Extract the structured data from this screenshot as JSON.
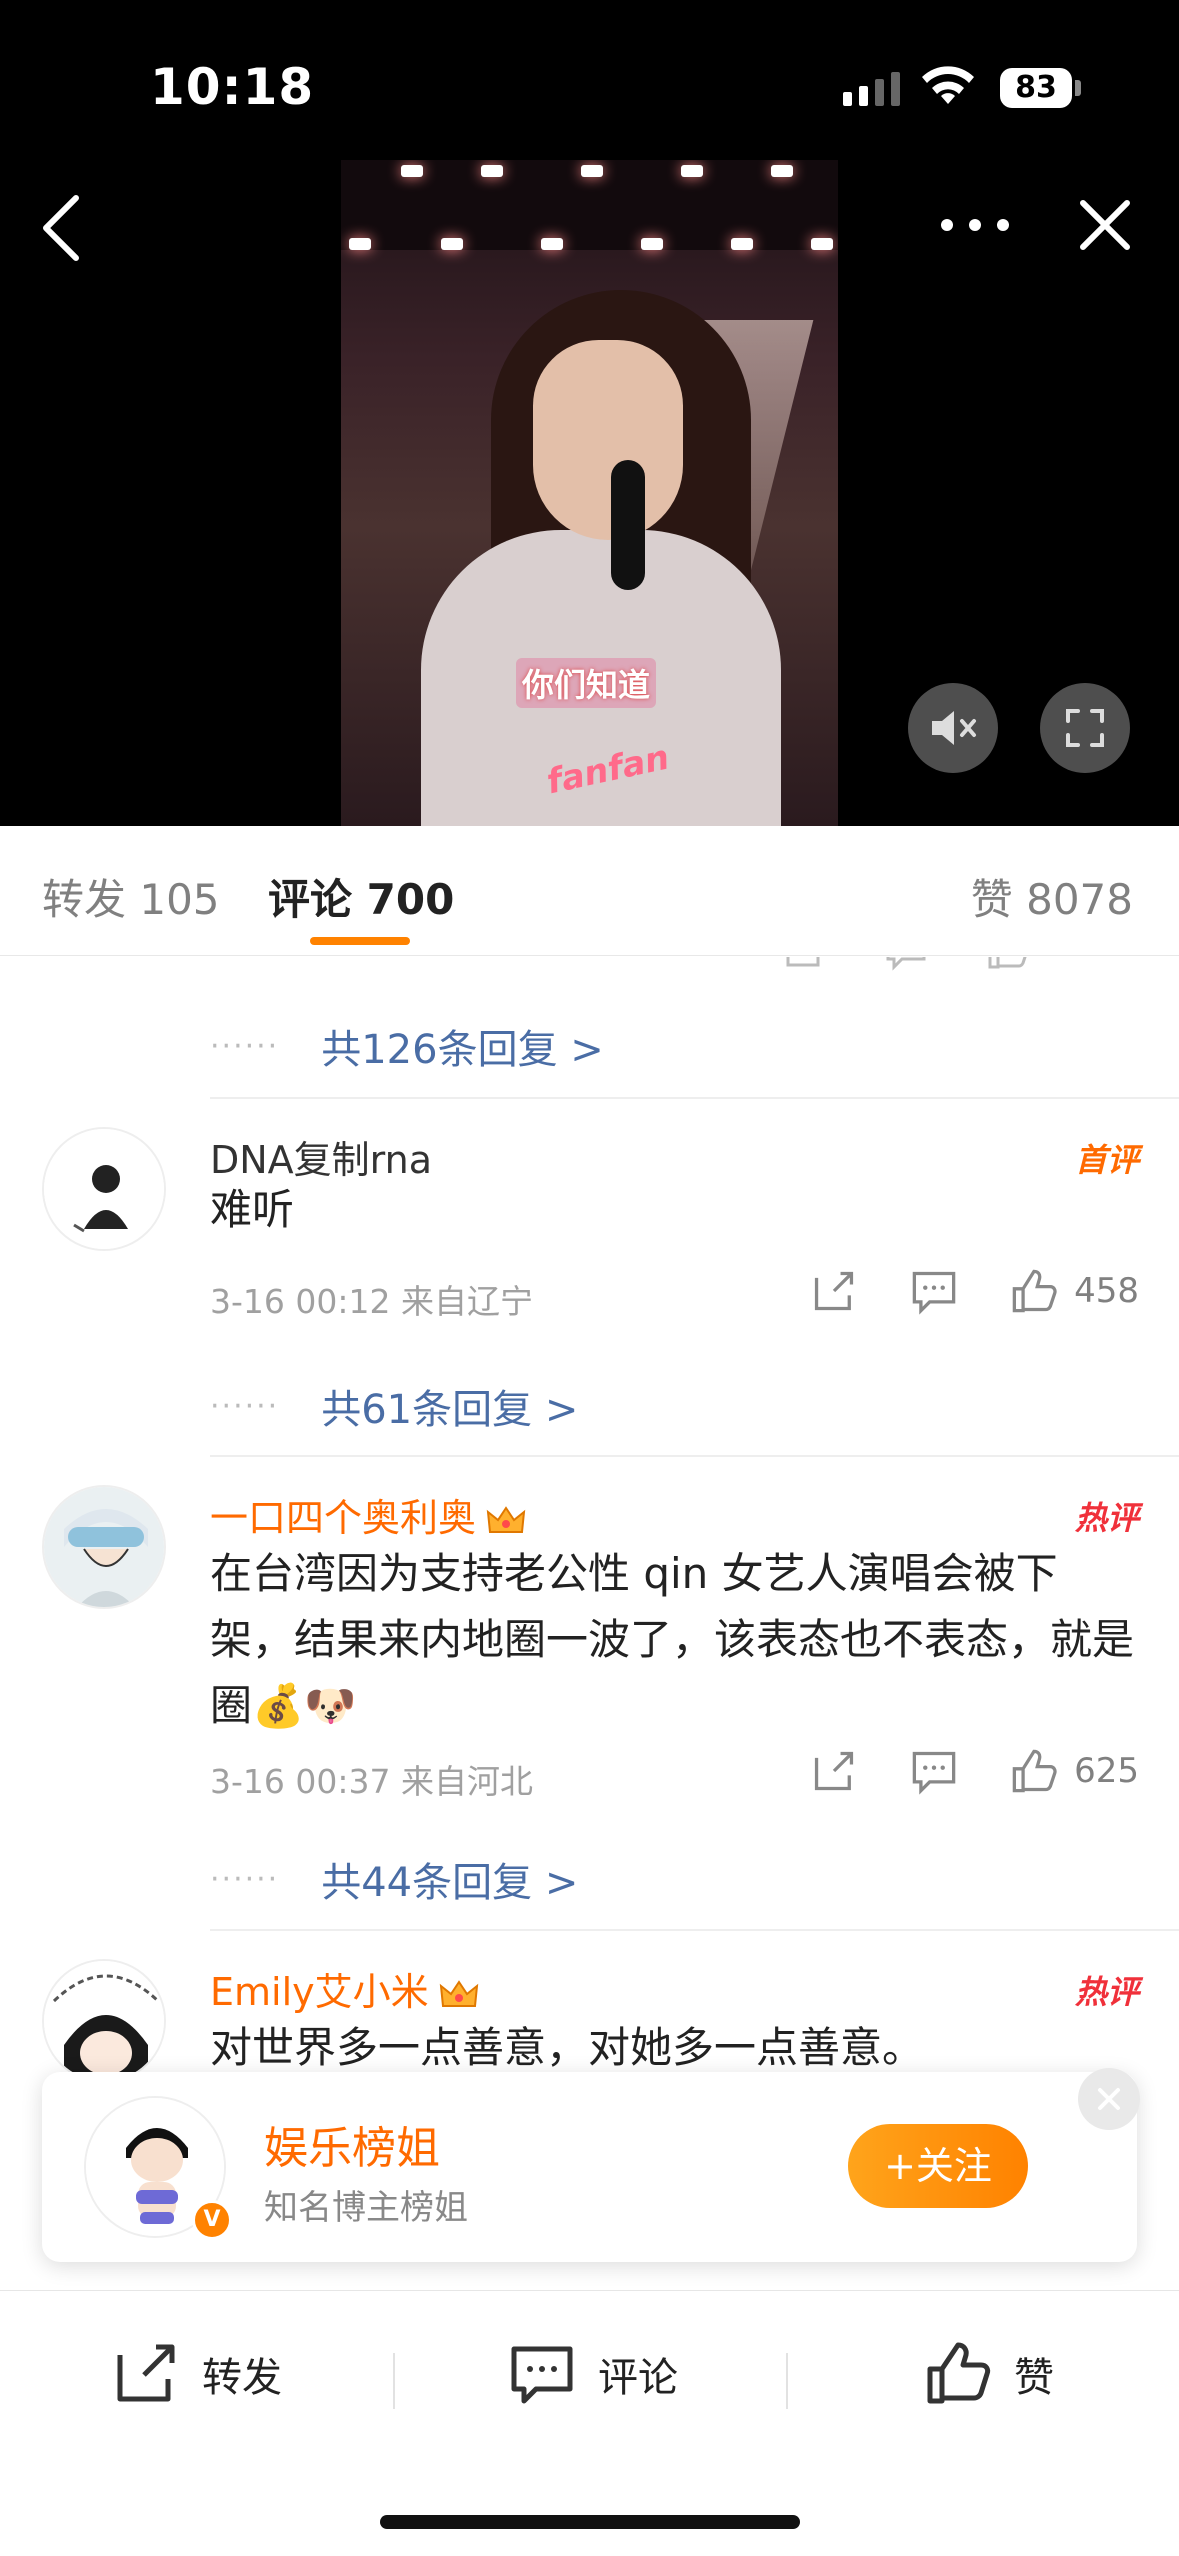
{
  "status": {
    "time": "10:18",
    "battery": "83"
  },
  "tabs": {
    "repost": "转发 105",
    "comments": "评论 700",
    "likes": "赞 8078"
  },
  "video": {
    "caption": "你们知道",
    "logo": "fanfan"
  },
  "comments": [
    {
      "reply_link": "共126条回复 >"
    },
    {
      "username": "DNA复制rna",
      "tag": "首评",
      "text": "难听",
      "meta": "3-16 00:12 来自辽宁",
      "likes": "458",
      "reply_link": "共61条回复 >"
    },
    {
      "username": "一口四个奥利奥",
      "tag": "热评",
      "text": "在台湾因为支持老公性 qin 女艺人演唱会被下架，结果来内地圈一波了，该表态也不表态，就是圈💰🐶",
      "meta": "3-16 00:37 来自河北",
      "likes": "625",
      "reply_link": "共44条回复 >"
    },
    {
      "username": "Emily艾小米",
      "tag": "热评",
      "text": "对世界多一点善意，对她多一点善意。"
    }
  ],
  "follow_card": {
    "name": "娱乐榜姐",
    "desc": "知名博主榜姐",
    "button": "+关注"
  },
  "bottom_bar": {
    "repost": "转发",
    "comment": "评论",
    "like": "赞"
  }
}
